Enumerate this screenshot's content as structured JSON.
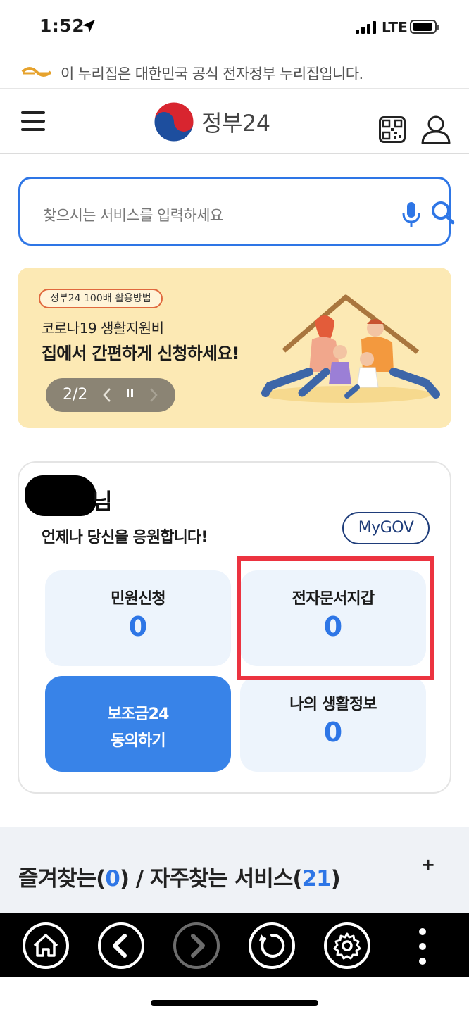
{
  "status_bar": {
    "time": "1:52",
    "network": "LTE"
  },
  "gov_notice": {
    "text": "이 누리집은 대한민국 공식 전자정부 누리집입니다."
  },
  "header": {
    "brand": "정부24"
  },
  "search": {
    "placeholder": "찾으시는 서비스를 입력하세요"
  },
  "banner": {
    "tag": "정부24 100배 활용방법",
    "line1": "코로나19 생활지원비",
    "line2": "집에서 간편하게 신청하세요!",
    "slide_counter": "2/2"
  },
  "dashboard": {
    "user_suffix": "님",
    "cheer": "언제나 당신을 응원합니다!",
    "mygov_label": "MyGOV",
    "tiles": [
      {
        "label": "민원신청",
        "count": "0"
      },
      {
        "label": "전자문서지갑",
        "count": "0"
      },
      {
        "label": "나의 생활정보",
        "count": "0"
      }
    ],
    "cta": {
      "line1": "보조금24",
      "line2": "동의하기"
    }
  },
  "favorites": {
    "prefix": "즐겨찾는(",
    "fav_count": "0",
    "middle": ") / 자주찾는 서비스(",
    "frequent_count": "21",
    "suffix": ")",
    "add_label": "+"
  },
  "toolbar": {
    "buttons": [
      "home-icon",
      "back-icon",
      "forward-icon",
      "reload-icon",
      "settings-icon",
      "more-icon"
    ]
  },
  "colors": {
    "accent": "#2e76e6",
    "highlight": "#ec3340",
    "banner_bg": "#fce9b4",
    "tile_bg": "#edf4fc",
    "cta_bg": "#3883e8"
  }
}
